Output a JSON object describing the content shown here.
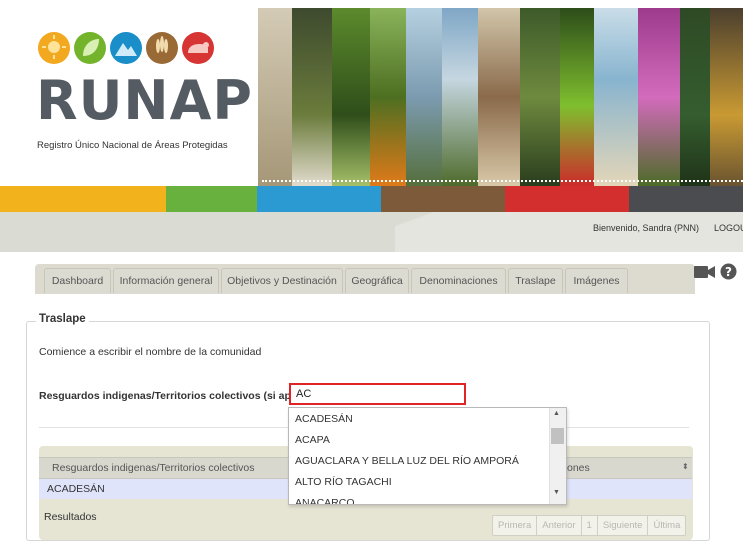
{
  "header": {
    "logo_text": "RUNAP",
    "logo_subtitle": "Registro Único Nacional de Áreas Protegidas",
    "logo_circles": [
      "sun-icon",
      "leaf-icon",
      "mountain-icon",
      "wheat-icon",
      "bear-icon"
    ],
    "circle_colors": [
      "#f2a81f",
      "#74b42d",
      "#1a8ec8",
      "#9a6a36",
      "#d63534"
    ]
  },
  "colorbar": [
    "#f2b21c",
    "#69b13f",
    "#2b9ad2",
    "#7d5a3a",
    "#d22f2e",
    "#4a4c50"
  ],
  "userbar": {
    "welcome": "Bienvenido, Sandra (PNN)",
    "logout": "LOGOUT"
  },
  "tabs": [
    {
      "label": "Dashboard"
    },
    {
      "label": "Información general"
    },
    {
      "label": "Objetivos y Destinación"
    },
    {
      "label": "Geográfica"
    },
    {
      "label": "Denominaciones"
    },
    {
      "label": "Traslape"
    },
    {
      "label": "Imágenes"
    }
  ],
  "tab_icons": [
    "video-camera-icon",
    "help-icon"
  ],
  "form": {
    "legend": "Traslape",
    "instruction": "Comience a escribir el nombre de la comunidad",
    "field_label": "Resguardos indigenas/Territorios colectivos (si aplica):",
    "field_value": "AC"
  },
  "autocomplete": {
    "items": [
      "ACADESÁN",
      "ACAPA",
      "AGUACLARA Y BELLA LUZ DEL RÍO AMPORÁ",
      "ALTO RÍO TAGACHI",
      "ANACARCO"
    ]
  },
  "grid": {
    "columns": [
      "Resguardos indigenas/Territorios colectivos",
      "ones"
    ],
    "rows": [
      [
        "ACADESÁN"
      ]
    ],
    "footer_label": "Resultados",
    "pager": [
      "Primera",
      "Anterior",
      "1",
      "Siguiente",
      "Última"
    ]
  }
}
